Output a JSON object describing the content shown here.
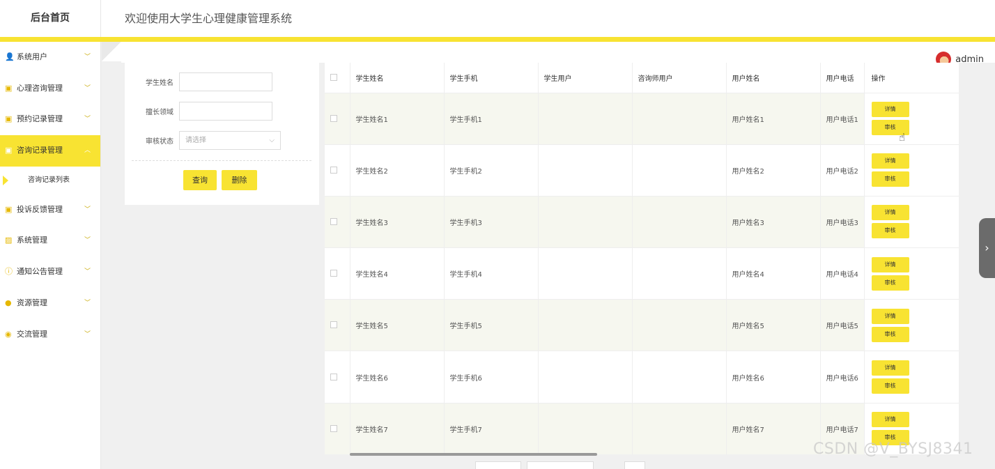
{
  "header": {
    "brand": "后台首页",
    "title": "欢迎使用大学生心理健康管理系统"
  },
  "user": {
    "name": "admin"
  },
  "sidebar": {
    "items": [
      {
        "label": "系统用户",
        "icon": "user-icon",
        "glyph": "👤"
      },
      {
        "label": "心理咨询管理",
        "icon": "note-icon",
        "glyph": "▣"
      },
      {
        "label": "预约记录管理",
        "icon": "note-icon",
        "glyph": "▣"
      },
      {
        "label": "咨询记录管理",
        "icon": "note-icon",
        "glyph": "▣",
        "active": true
      },
      {
        "label": "投诉反馈管理",
        "icon": "note-icon",
        "glyph": "▣"
      },
      {
        "label": "系统管理",
        "icon": "image-icon",
        "glyph": "▨"
      },
      {
        "label": "通知公告管理",
        "icon": "info-icon",
        "glyph": "ⓘ"
      },
      {
        "label": "资源管理",
        "icon": "bulb-icon",
        "glyph": "●"
      },
      {
        "label": "交流管理",
        "icon": "chat-icon",
        "glyph": "◉"
      }
    ],
    "sub_item": "咨询记录列表"
  },
  "search": {
    "fields": [
      {
        "label": "学生姓名",
        "value": ""
      },
      {
        "label": "擅长领域",
        "value": ""
      }
    ],
    "status_label": "审核状态",
    "status_placeholder": "请选择",
    "query_button": "查询",
    "delete_button": "删除"
  },
  "table": {
    "headers": [
      "学生姓名",
      "学生手机",
      "学生用户",
      "咨询师用户",
      "用户姓名",
      "用户电话",
      "操作"
    ],
    "rows": [
      [
        "学生姓名1",
        "学生手机1",
        "",
        "",
        "用户姓名1",
        "用户电话1"
      ],
      [
        "学生姓名2",
        "学生手机2",
        "",
        "",
        "用户姓名2",
        "用户电话2"
      ],
      [
        "学生姓名3",
        "学生手机3",
        "",
        "",
        "用户姓名3",
        "用户电话3"
      ],
      [
        "学生姓名4",
        "学生手机4",
        "",
        "",
        "用户姓名4",
        "用户电话4"
      ],
      [
        "学生姓名5",
        "学生手机5",
        "",
        "",
        "用户姓名5",
        "用户电话5"
      ],
      [
        "学生姓名6",
        "学生手机6",
        "",
        "",
        "用户姓名6",
        "用户电话6"
      ],
      [
        "学生姓名7",
        "学生手机7",
        "",
        "",
        "用户姓名7",
        "用户电话7"
      ]
    ],
    "detail_button": "详情",
    "review_button": "审核"
  },
  "watermark": "CSDN @V_BYSJ8341",
  "colors": {
    "accent": "#f8e332",
    "stripe": "#f6f7ef"
  }
}
